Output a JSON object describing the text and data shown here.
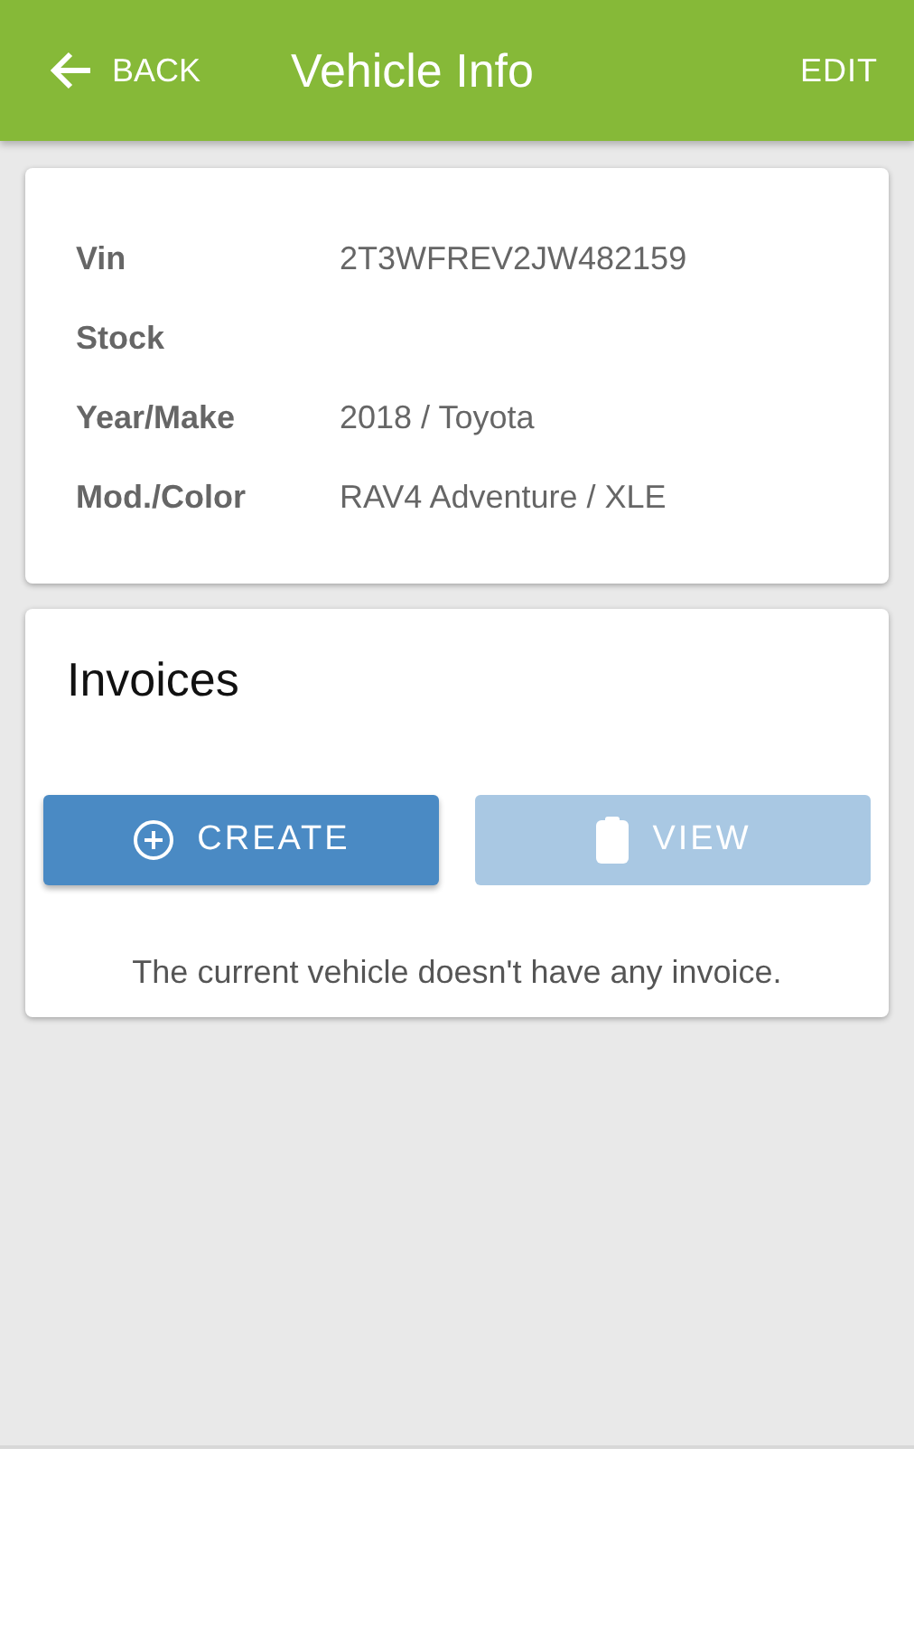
{
  "header": {
    "back": "BACK",
    "title": "Vehicle Info",
    "action": "EDIT"
  },
  "vehicle": [
    {
      "label": "Vin",
      "value": "2T3WFREV2JW482159"
    },
    {
      "label": "Stock"
    },
    {
      "label": "Year/Make",
      "value": "2018 / Toyota"
    },
    {
      "label": "Mod./Color",
      "value": "RAV4 Adventure / XLE"
    }
  ],
  "invoices": {
    "title": "Invoices",
    "buttons": [
      {
        "label": "CREATE",
        "kind": "create",
        "disabled": false
      },
      {
        "label": "VIEW",
        "kind": "view",
        "disabled": true
      }
    ],
    "message": "The current vehicle doesn't have any invoice."
  }
}
